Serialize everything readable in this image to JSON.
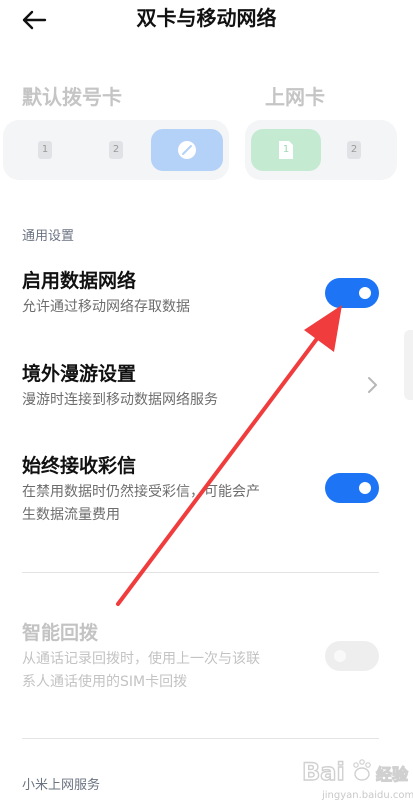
{
  "header": {
    "title": "双卡与移动网络",
    "back_icon": "arrow-left-icon"
  },
  "sim_selector": {
    "default_dial_label": "默认拨号卡",
    "data_label": "上网卡",
    "default_dial_options": [
      "1",
      "2"
    ],
    "default_dial_selected": "auto",
    "data_options": [
      "1",
      "2"
    ],
    "data_selected": "1",
    "colors": {
      "auto_selected": "#b4d1f7",
      "data_selected": "#c4ead2"
    }
  },
  "general": {
    "section_label": "通用设置",
    "mobile_data": {
      "title": "启用数据网络",
      "desc": "允许通过移动网络存取数据",
      "enabled": true
    },
    "roaming": {
      "title": "境外漫游设置",
      "desc": "漫游时连接到移动数据网络服务"
    },
    "mms": {
      "title": "始终接收彩信",
      "desc_line1": "在禁用数据时仍然接受彩信，可能会产",
      "desc_line2": "生数据流量费用",
      "enabled": true
    },
    "smart_redial": {
      "title": "智能回拨",
      "desc_line1": "从通话记录回拨时，使用上一次与该联",
      "desc_line2": "系人通话使用的SIM卡回拨",
      "enabled": false
    }
  },
  "xiaomi_section": {
    "section_label": "小米上网服务"
  },
  "watermark": {
    "text": "Bai经验",
    "url": "jingyan.baidu.com"
  },
  "accent_color": "#1d74f5",
  "annotation_color": "#f03c3c"
}
